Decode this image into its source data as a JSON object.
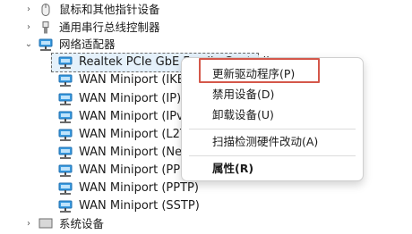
{
  "tree": {
    "mouse": {
      "label": "鼠标和其他指针设备",
      "expander": "›",
      "icon": "mouse-icon"
    },
    "usb": {
      "label": "通用串行总线控制器",
      "expander": "›",
      "icon": "usb-icon"
    },
    "network": {
      "label": "网络适配器",
      "expander": "⌄",
      "icon": "network-adapter-icon"
    },
    "adapters": [
      "Realtek PCIe GbE Family Controller",
      "WAN Miniport (IKEv2)",
      "WAN Miniport (IP)",
      "WAN Miniport (IPv6)",
      "WAN Miniport (L2TP)",
      "WAN Miniport (Network Monitor)",
      "WAN Miniport (PPPOE)",
      "WAN Miniport (PPTP)",
      "WAN Miniport (SSTP)"
    ],
    "system": {
      "label": "系统设备",
      "expander": "›"
    }
  },
  "context_menu": {
    "update_driver": "更新驱动程序(P)",
    "disable_device": "禁用设备(D)",
    "uninstall_device": "卸载设备(U)",
    "scan_hardware": "扫描检测硬件改动(A)",
    "properties": "属性(R)"
  },
  "colors": {
    "highlight_box": "#d4574a",
    "selection": "#e5f1fb",
    "network_icon": "#2e8bd6"
  }
}
